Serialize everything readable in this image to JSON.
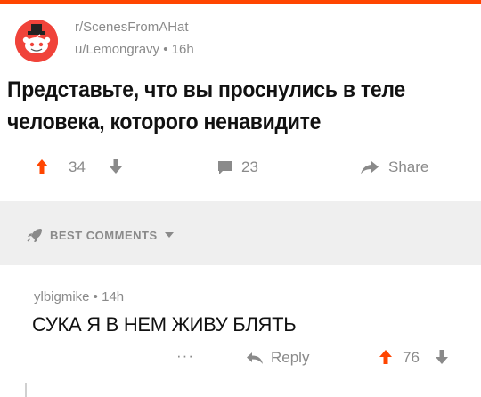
{
  "post": {
    "subreddit": "r/ScenesFromAHat",
    "author_line": "u/Lemongravy • 16h",
    "title": "Представьте, что вы проснулись в теле человека, которого ненавидите",
    "votes": "34",
    "comments": "23",
    "share_label": "Share"
  },
  "comments_header": {
    "label": "BEST COMMENTS"
  },
  "comment": {
    "meta": "ylbigmike • 14h",
    "body": "СУКА Я В НЕМ ЖИВУ БЛЯТЬ",
    "more": "···",
    "reply_label": "Reply",
    "votes": "76"
  },
  "colors": {
    "accent_upvote": "#ff4500",
    "downvote_blue": "#7193ff",
    "muted_text": "#8a8a8a",
    "header_bg": "#efefef"
  }
}
